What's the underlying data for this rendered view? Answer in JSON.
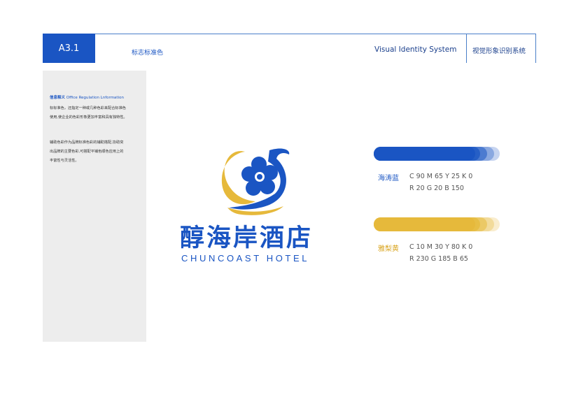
{
  "header": {
    "code": "A3.1",
    "section": "标志标准色",
    "system_en": "Visual Identity System",
    "system_cn": "视觉形象识别系统"
  },
  "sidebar": {
    "title_cn": "信息释义",
    "title_en": "Office Regulation Lnformation",
    "paragraph1_line1": "标标准色，还指定一种或几种色彩来配合标准色",
    "paragraph1_line2": "使用,使企业的色彩形象更加丰富和具有独特性。",
    "paragraph2_line1": "辅助色彩作为品牌标准色彩的辅助搭配,协助突",
    "paragraph2_line2": "出品牌的主要色彩,可搭配平铺色顺色应用上的",
    "paragraph2_line3": "丰富性与灵活性。"
  },
  "logo": {
    "name_cn": "醇海岸酒店",
    "name_en": "CHUNCOAST HOTEL"
  },
  "colors": [
    {
      "name": "海涛蓝",
      "cmyk": "C 90 M 65 Y 25 K 0",
      "rgb": "R 20  G 20  B 150",
      "hex": "#1a55c3"
    },
    {
      "name": "雅梨黄",
      "cmyk": "C 10 M 30 Y 80  K 0",
      "rgb": "R 230  G 185  B 65",
      "hex": "#e6b93b"
    }
  ]
}
